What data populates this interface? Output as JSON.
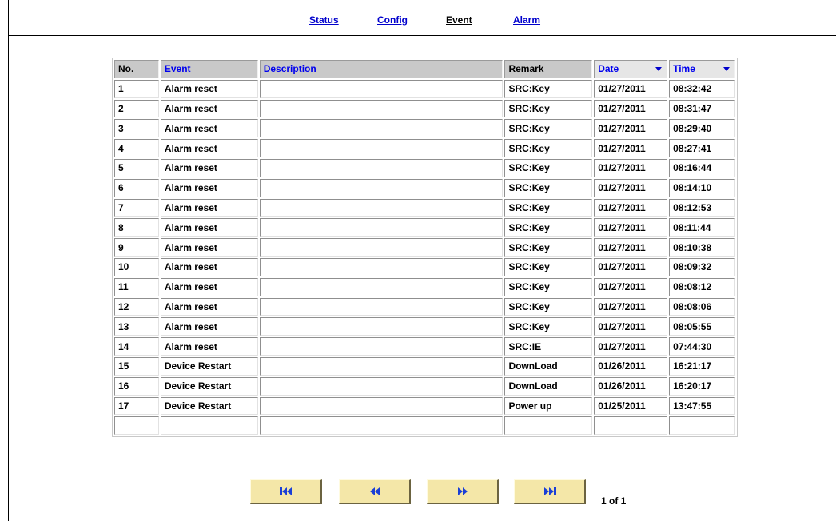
{
  "nav": {
    "status": "Status",
    "config": "Config",
    "event": "Event",
    "alarm": "Alarm"
  },
  "table": {
    "headers": {
      "no": "No.",
      "event": "Event",
      "description": "Description",
      "remark": "Remark",
      "date": "Date",
      "time": "Time"
    },
    "rows": [
      {
        "no": "1",
        "event": "Alarm reset",
        "description": "",
        "remark": "SRC:Key",
        "date": "01/27/2011",
        "time": "08:32:42"
      },
      {
        "no": "2",
        "event": "Alarm reset",
        "description": "",
        "remark": "SRC:Key",
        "date": "01/27/2011",
        "time": "08:31:47"
      },
      {
        "no": "3",
        "event": "Alarm reset",
        "description": "",
        "remark": "SRC:Key",
        "date": "01/27/2011",
        "time": "08:29:40"
      },
      {
        "no": "4",
        "event": "Alarm reset",
        "description": "",
        "remark": "SRC:Key",
        "date": "01/27/2011",
        "time": "08:27:41"
      },
      {
        "no": "5",
        "event": "Alarm reset",
        "description": "",
        "remark": "SRC:Key",
        "date": "01/27/2011",
        "time": "08:16:44"
      },
      {
        "no": "6",
        "event": "Alarm reset",
        "description": "",
        "remark": "SRC:Key",
        "date": "01/27/2011",
        "time": "08:14:10"
      },
      {
        "no": "7",
        "event": "Alarm reset",
        "description": "",
        "remark": "SRC:Key",
        "date": "01/27/2011",
        "time": "08:12:53"
      },
      {
        "no": "8",
        "event": "Alarm reset",
        "description": "",
        "remark": "SRC:Key",
        "date": "01/27/2011",
        "time": "08:11:44"
      },
      {
        "no": "9",
        "event": "Alarm reset",
        "description": "",
        "remark": "SRC:Key",
        "date": "01/27/2011",
        "time": "08:10:38"
      },
      {
        "no": "10",
        "event": "Alarm reset",
        "description": "",
        "remark": "SRC:Key",
        "date": "01/27/2011",
        "time": "08:09:32"
      },
      {
        "no": "11",
        "event": "Alarm reset",
        "description": "",
        "remark": "SRC:Key",
        "date": "01/27/2011",
        "time": "08:08:12"
      },
      {
        "no": "12",
        "event": "Alarm reset",
        "description": "",
        "remark": "SRC:Key",
        "date": "01/27/2011",
        "time": "08:08:06"
      },
      {
        "no": "13",
        "event": "Alarm reset",
        "description": "",
        "remark": "SRC:Key",
        "date": "01/27/2011",
        "time": "08:05:55"
      },
      {
        "no": "14",
        "event": "Alarm reset",
        "description": "",
        "remark": "SRC:IE",
        "date": "01/27/2011",
        "time": "07:44:30"
      },
      {
        "no": "15",
        "event": "Device Restart",
        "description": "",
        "remark": "DownLoad",
        "date": "01/26/2011",
        "time": "16:21:17"
      },
      {
        "no": "16",
        "event": "Device Restart",
        "description": "",
        "remark": "DownLoad",
        "date": "01/26/2011",
        "time": "16:20:17"
      },
      {
        "no": "17",
        "event": "Device Restart",
        "description": "",
        "remark": "Power up",
        "date": "01/25/2011",
        "time": "13:47:55"
      },
      {
        "no": "",
        "event": "",
        "description": "",
        "remark": "",
        "date": "",
        "time": ""
      }
    ]
  },
  "pager": {
    "first_icon": "first-page-icon",
    "prev_icon": "previous-page-icon",
    "next_icon": "next-page-icon",
    "last_icon": "last-page-icon",
    "info": "1 of 1"
  },
  "colors": {
    "link": "#0000cc",
    "header_bg": "#c9c9c9",
    "pager_bg": "#f4e7a8",
    "icon": "#1a3fd6"
  }
}
